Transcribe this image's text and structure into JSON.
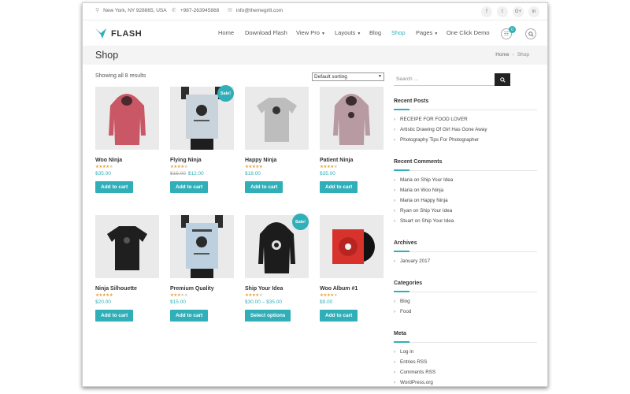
{
  "topbar": {
    "address": "New York, NY 928865, USA",
    "phone": "+987-263945868",
    "email": "info@themegrill.com",
    "social": [
      "f",
      "t",
      "G+",
      "in"
    ]
  },
  "header": {
    "logo_text": "FLASH",
    "nav": [
      "Home",
      "Download Flash",
      "View Pro",
      "Layouts",
      "Blog",
      "Shop",
      "Pages",
      "One Click Demo"
    ],
    "active_nav": "Shop",
    "cart_count": "0"
  },
  "page": {
    "title": "Shop",
    "breadcrumb": [
      "Home",
      "Shop"
    ]
  },
  "shop": {
    "results": "Showing all 8 results",
    "sorting": "Default sorting",
    "products": [
      {
        "name": "Woo Ninja",
        "price": "$35.00",
        "old_price": "",
        "rating": 4,
        "button": "Add to cart",
        "sale": false
      },
      {
        "name": "Flying Ninja",
        "price": "$12.00",
        "old_price": "$15.00",
        "rating": 4,
        "button": "Add to cart",
        "sale": true
      },
      {
        "name": "Happy Ninja",
        "price": "$18.00",
        "old_price": "",
        "rating": 5,
        "button": "Add to cart",
        "sale": false
      },
      {
        "name": "Patient Ninja",
        "price": "$35.00",
        "old_price": "",
        "rating": 4,
        "button": "Add to cart",
        "sale": false
      },
      {
        "name": "Ninja Silhouette",
        "price": "$20.00",
        "old_price": "",
        "rating": 5,
        "button": "Add to cart",
        "sale": false
      },
      {
        "name": "Premium Quality",
        "price": "$15.00",
        "old_price": "",
        "rating": 3,
        "button": "Add to cart",
        "sale": false
      },
      {
        "name": "Ship Your Idea",
        "price": "$30.00 – $35.00",
        "old_price": "",
        "rating": 4,
        "button": "Select options",
        "sale": true
      },
      {
        "name": "Woo Album #1",
        "price": "$9.00",
        "old_price": "",
        "rating": 4,
        "button": "Add to cart",
        "sale": false
      }
    ],
    "sale_label": "Sale!"
  },
  "sidebar": {
    "search_placeholder": "Search ...",
    "recent_posts_title": "Recent Posts",
    "recent_posts": [
      "RECEIPE FOR FOOD LOVER",
      "Artistic Drawing Of Girl Has Gone Away",
      "Photography Tips For Photographer"
    ],
    "recent_comments_title": "Recent Comments",
    "recent_comments": [
      {
        "author": "Maria",
        "on": "on",
        "post": "Ship Your Idea"
      },
      {
        "author": "Maria",
        "on": "on",
        "post": "Woo Ninja"
      },
      {
        "author": "Maria",
        "on": "on",
        "post": "Happy Ninja"
      },
      {
        "author": "Ryan",
        "on": "on",
        "post": "Ship Your Idea"
      },
      {
        "author": "Stuart",
        "on": "on",
        "post": "Ship Your Idea"
      }
    ],
    "archives_title": "Archives",
    "archives": [
      "January 2017"
    ],
    "categories_title": "Categories",
    "categories": [
      "Blog",
      "Food"
    ],
    "meta_title": "Meta",
    "meta": [
      "Log in",
      "Entries RSS",
      "Comments RSS",
      "WordPress.org"
    ]
  },
  "colors": {
    "accent": "#30afb8",
    "star": "#e9a23b"
  }
}
